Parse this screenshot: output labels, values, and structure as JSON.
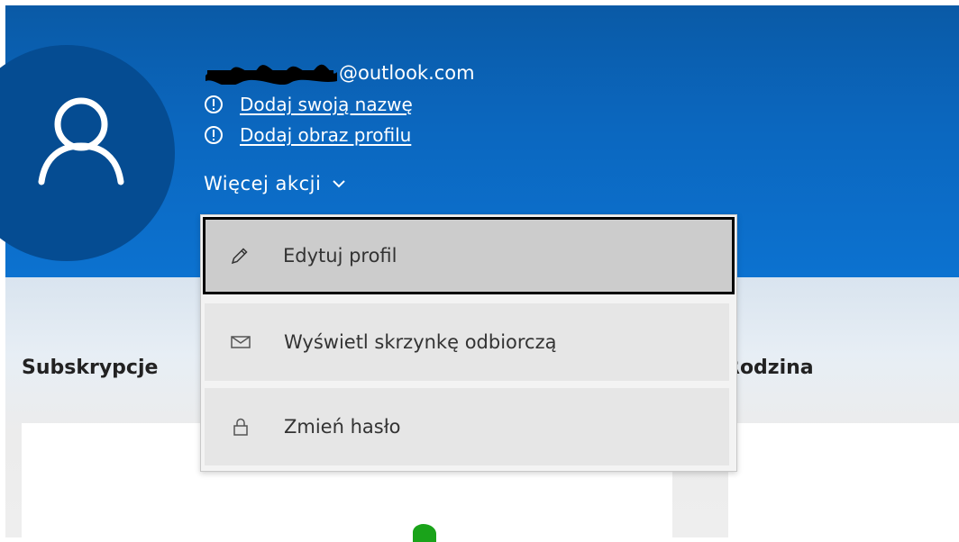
{
  "profile": {
    "email_suffix": "@outlook.com",
    "add_name_link": "Dodaj swoją nazwę",
    "add_picture_link": "Dodaj obraz profilu",
    "more_actions_label": "Więcej akcji"
  },
  "menu": {
    "items": [
      {
        "label": "Edytuj profil",
        "icon": "pencil-icon"
      },
      {
        "label": "Wyświetl skrzynkę odbiorczą",
        "icon": "envelope-icon"
      },
      {
        "label": "Zmień hasło",
        "icon": "lock-icon"
      }
    ]
  },
  "sections": {
    "subscriptions_title": "Subskrypcje",
    "family_title": "Rodzina"
  },
  "colors": {
    "header_blue": "#0b67bf",
    "avatar_bg": "#054c92",
    "selected_item_bg": "#cccccc",
    "item_bg": "#e6e6e6"
  }
}
